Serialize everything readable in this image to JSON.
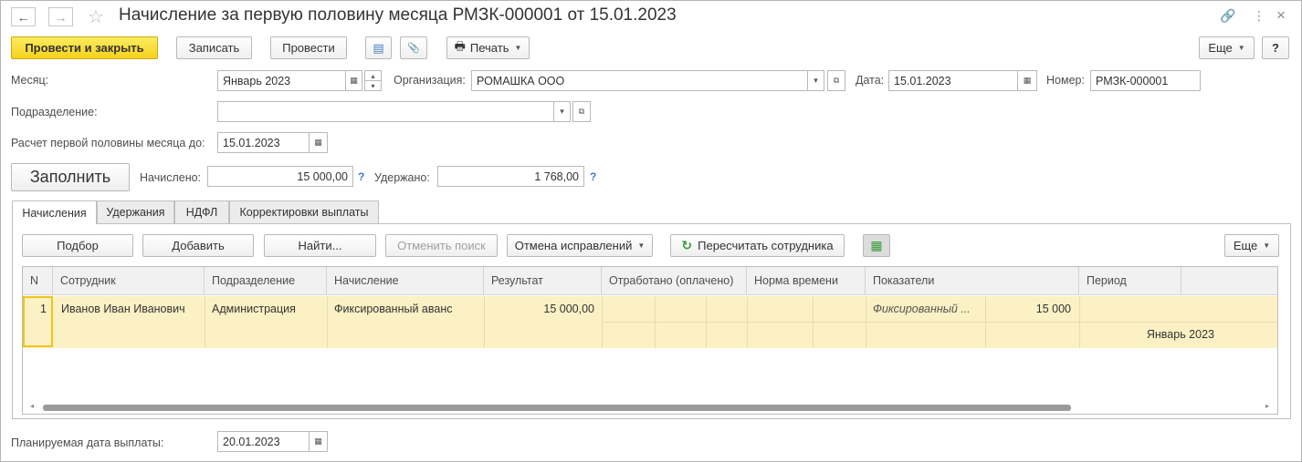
{
  "window": {
    "title": "Начисление за первую половину месяца РМЗК-000001 от 15.01.2023",
    "back_glyph": "←",
    "forward_glyph": "→",
    "star_glyph": "☆",
    "link_glyph": "🔗",
    "more_glyph": "⋮",
    "close_glyph": "×"
  },
  "toolbar": {
    "post_close": "Провести и закрыть",
    "save": "Записать",
    "post": "Провести",
    "print": "Печать",
    "more": "Еще",
    "help": "?",
    "print_glyph": "🖶",
    "report_glyph": "▤",
    "attach_glyph": "📎"
  },
  "form": {
    "month_label": "Месяц:",
    "month_value": "Январь 2023",
    "org_label": "Организация:",
    "org_value": "РОМАШКА ООО",
    "date_label": "Дата:",
    "date_value": "15.01.2023",
    "number_label": "Номер:",
    "number_value": "РМЗК-000001",
    "dept_label": "Подразделение:",
    "dept_value": "",
    "calc_label": "Расчет первой половины месяца до:",
    "calc_value": "15.01.2023",
    "fill_button": "Заполнить",
    "accrued_label": "Начислено:",
    "accrued_value": "15 000,00",
    "withheld_label": "Удержано:",
    "withheld_value": "1 768,00",
    "help_mark": "?",
    "planned_label": "Планируемая дата выплаты:",
    "planned_value": "20.01.2023",
    "calendar_glyph": "▦",
    "dropdown_glyph": "▾",
    "open_glyph": "⧉",
    "spin_up": "▴",
    "spin_down": "▾"
  },
  "tabs": [
    {
      "label": "Начисления",
      "active": true
    },
    {
      "label": "Удержания",
      "active": false
    },
    {
      "label": "НДФЛ",
      "active": false
    },
    {
      "label": "Корректировки выплаты",
      "active": false
    }
  ],
  "table_toolbar": {
    "pick": "Подбор",
    "add": "Добавить",
    "find": "Найти...",
    "cancel_search": "Отменить поиск",
    "cancel_corrections": "Отмена исправлений",
    "recalc": "Пересчитать сотрудника",
    "more": "Еще",
    "recalc_glyph": "↻",
    "grid_glyph": "▦"
  },
  "table": {
    "columns": [
      "N",
      "Сотрудник",
      "Подразделение",
      "Начисление",
      "Результат",
      "Отработано (оплачено)",
      "Норма времени",
      "Показатели",
      "Период"
    ],
    "rows": [
      {
        "n": "1",
        "employee": "Иванов Иван Иванович",
        "department": "Администрация",
        "accrual": "Фиксированный аванс",
        "result": "15 000,00",
        "indicator_name": "Фиксированный ...",
        "indicator_value": "15 000",
        "period": "Январь 2023"
      }
    ],
    "scroll_left": "◂",
    "scroll_right": "▸"
  },
  "colors": {
    "primary_button": "#f5d21c",
    "selected_row": "#fbf1c4",
    "help_blue": "#3f78c4",
    "recalc_green": "#3a9a3a"
  }
}
